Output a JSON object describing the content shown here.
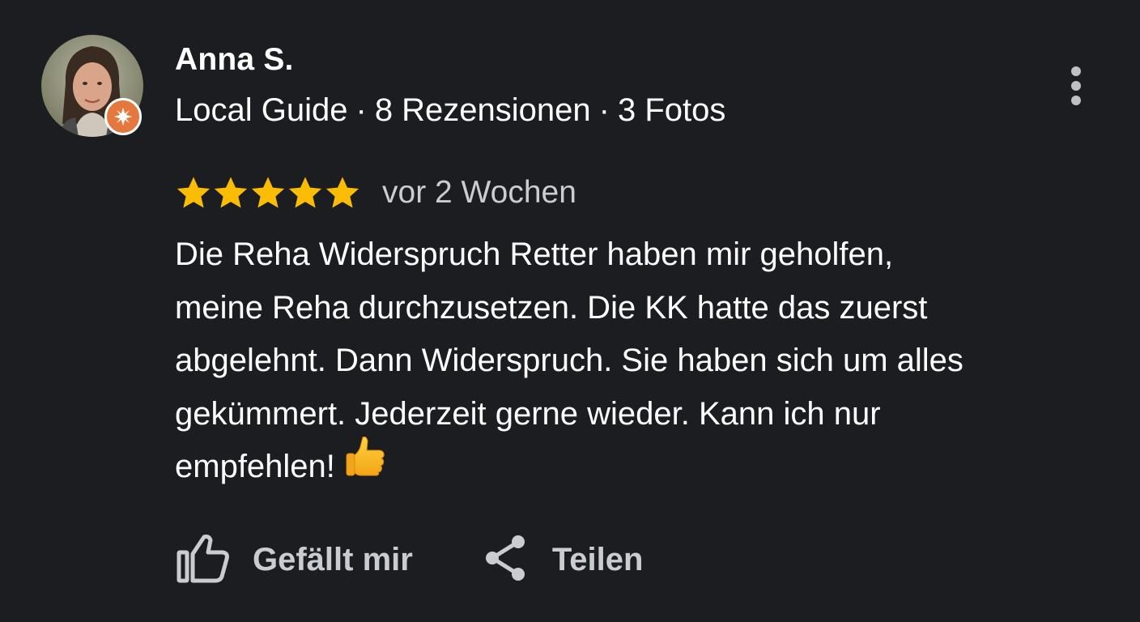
{
  "review": {
    "author": {
      "name": "Anna S.",
      "role": "Local Guide",
      "reviews": "8 Rezensionen",
      "photos": "3 Fotos",
      "separator": "·"
    },
    "rating": 5,
    "max_rating": 5,
    "date": "vor 2 Wochen",
    "text_lines": [
      "Die Reha Widerspruch Retter haben mir geholfen,",
      "meine Reha durchzusetzen. Die KK hatte das zuerst",
      "abgelehnt. Dann Widerspruch. Sie haben sich um alles",
      "gekümmert. Jederzeit gerne wieder. Kann ich nur",
      "empfehlen!"
    ],
    "emoji": "thumbs-up-icon"
  },
  "actions": {
    "like_label": "Gefällt mir",
    "share_label": "Teilen"
  },
  "colors": {
    "background": "#1c1d20",
    "star": "#fbbc04",
    "badge": "#e5783f",
    "muted_text": "#c9ccd1"
  },
  "icons": [
    "more-vert-icon",
    "star-icon",
    "local-guide-badge-icon",
    "thumbs-up-outline-icon",
    "share-icon"
  ]
}
